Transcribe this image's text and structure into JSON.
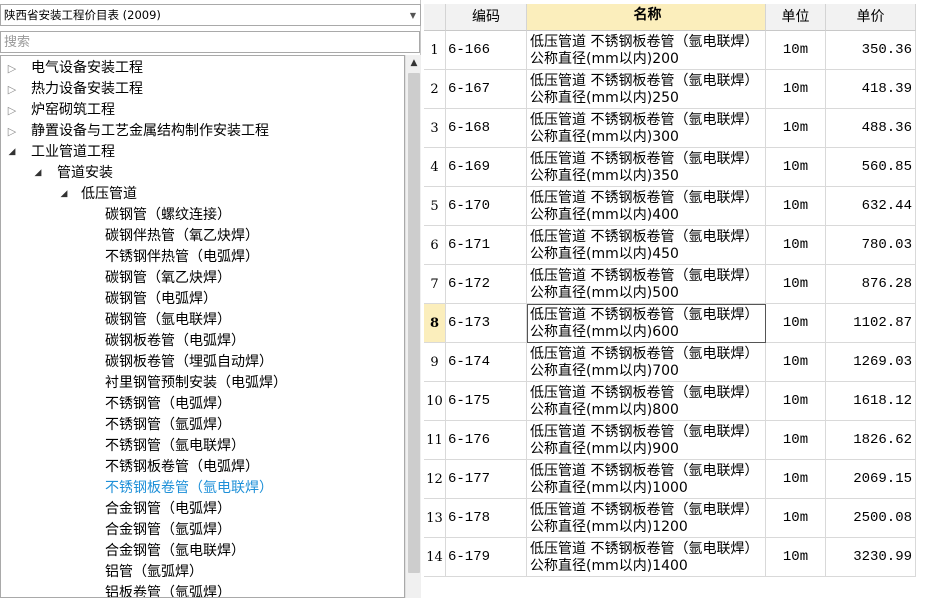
{
  "library_select": {
    "value": "陕西省安装工程价目表 (2009)"
  },
  "search": {
    "placeholder": "搜索"
  },
  "tree": [
    {
      "label": "电气设备安装工程",
      "level": 0,
      "state": "collapsed"
    },
    {
      "label": "热力设备安装工程",
      "level": 0,
      "state": "collapsed"
    },
    {
      "label": "炉窑砌筑工程",
      "level": 0,
      "state": "collapsed"
    },
    {
      "label": "静置设备与工艺金属结构制作安装工程",
      "level": 0,
      "state": "collapsed"
    },
    {
      "label": "工业管道工程",
      "level": 0,
      "state": "expanded"
    },
    {
      "label": "管道安装",
      "level": 1,
      "state": "expanded"
    },
    {
      "label": "低压管道",
      "level": 2,
      "state": "expanded"
    },
    {
      "label": "碳钢管（螺纹连接）",
      "level": 3,
      "state": "leaf"
    },
    {
      "label": "碳钢伴热管（氧乙炔焊）",
      "level": 3,
      "state": "leaf"
    },
    {
      "label": "不锈钢伴热管（电弧焊）",
      "level": 3,
      "state": "leaf"
    },
    {
      "label": "碳钢管（氧乙炔焊）",
      "level": 3,
      "state": "leaf"
    },
    {
      "label": "碳钢管（电弧焊）",
      "level": 3,
      "state": "leaf"
    },
    {
      "label": "碳钢管（氩电联焊）",
      "level": 3,
      "state": "leaf"
    },
    {
      "label": "碳钢板卷管（电弧焊）",
      "level": 3,
      "state": "leaf"
    },
    {
      "label": "碳钢板卷管（埋弧自动焊）",
      "level": 3,
      "state": "leaf"
    },
    {
      "label": "衬里钢管预制安装（电弧焊）",
      "level": 3,
      "state": "leaf"
    },
    {
      "label": "不锈钢管（电弧焊）",
      "level": 3,
      "state": "leaf"
    },
    {
      "label": "不锈钢管（氩弧焊）",
      "level": 3,
      "state": "leaf"
    },
    {
      "label": "不锈钢管（氩电联焊）",
      "level": 3,
      "state": "leaf"
    },
    {
      "label": "不锈钢板卷管（电弧焊）",
      "level": 3,
      "state": "leaf"
    },
    {
      "label": "不锈钢板卷管（氩电联焊）",
      "level": 3,
      "state": "leaf",
      "selected": true
    },
    {
      "label": "合金钢管（电弧焊）",
      "level": 3,
      "state": "leaf"
    },
    {
      "label": "合金钢管（氩弧焊）",
      "level": 3,
      "state": "leaf"
    },
    {
      "label": "合金钢管（氩电联焊）",
      "level": 3,
      "state": "leaf"
    },
    {
      "label": "铝管（氩弧焊）",
      "level": 3,
      "state": "leaf"
    },
    {
      "label": "铝板卷管（氩弧焊）",
      "level": 3,
      "state": "leaf"
    }
  ],
  "grid": {
    "headers": {
      "code": "编码",
      "name": "名称",
      "unit": "单位",
      "price": "单价"
    },
    "active_row": 8,
    "rows": [
      {
        "n": "1",
        "code": "6-166",
        "name": "低压管道 不锈钢板卷管（氩电联焊） 公称直径(mm以内)200",
        "unit": "10m",
        "price": "350.36"
      },
      {
        "n": "2",
        "code": "6-167",
        "name": "低压管道 不锈钢板卷管（氩电联焊） 公称直径(mm以内)250",
        "unit": "10m",
        "price": "418.39"
      },
      {
        "n": "3",
        "code": "6-168",
        "name": "低压管道 不锈钢板卷管（氩电联焊） 公称直径(mm以内)300",
        "unit": "10m",
        "price": "488.36"
      },
      {
        "n": "4",
        "code": "6-169",
        "name": "低压管道 不锈钢板卷管（氩电联焊） 公称直径(mm以内)350",
        "unit": "10m",
        "price": "560.85"
      },
      {
        "n": "5",
        "code": "6-170",
        "name": "低压管道 不锈钢板卷管（氩电联焊） 公称直径(mm以内)400",
        "unit": "10m",
        "price": "632.44"
      },
      {
        "n": "6",
        "code": "6-171",
        "name": "低压管道 不锈钢板卷管（氩电联焊） 公称直径(mm以内)450",
        "unit": "10m",
        "price": "780.03"
      },
      {
        "n": "7",
        "code": "6-172",
        "name": "低压管道 不锈钢板卷管（氩电联焊） 公称直径(mm以内)500",
        "unit": "10m",
        "price": "876.28"
      },
      {
        "n": "8",
        "code": "6-173",
        "name": "低压管道 不锈钢板卷管（氩电联焊） 公称直径(mm以内)600",
        "unit": "10m",
        "price": "1102.87"
      },
      {
        "n": "9",
        "code": "6-174",
        "name": "低压管道 不锈钢板卷管（氩电联焊） 公称直径(mm以内)700",
        "unit": "10m",
        "price": "1269.03"
      },
      {
        "n": "10",
        "code": "6-175",
        "name": "低压管道 不锈钢板卷管（氩电联焊） 公称直径(mm以内)800",
        "unit": "10m",
        "price": "1618.12"
      },
      {
        "n": "11",
        "code": "6-176",
        "name": "低压管道 不锈钢板卷管（氩电联焊） 公称直径(mm以内)900",
        "unit": "10m",
        "price": "1826.62"
      },
      {
        "n": "12",
        "code": "6-177",
        "name": "低压管道 不锈钢板卷管（氩电联焊） 公称直径(mm以内)1000",
        "unit": "10m",
        "price": "2069.15"
      },
      {
        "n": "13",
        "code": "6-178",
        "name": "低压管道 不锈钢板卷管（氩电联焊） 公称直径(mm以内)1200",
        "unit": "10m",
        "price": "2500.08"
      },
      {
        "n": "14",
        "code": "6-179",
        "name": "低压管道 不锈钢板卷管（氩电联焊） 公称直径(mm以内)1400",
        "unit": "10m",
        "price": "3230.99"
      }
    ]
  },
  "icons": {
    "collapsed": "triangle-right-icon",
    "expanded": "triangle-down-icon"
  }
}
